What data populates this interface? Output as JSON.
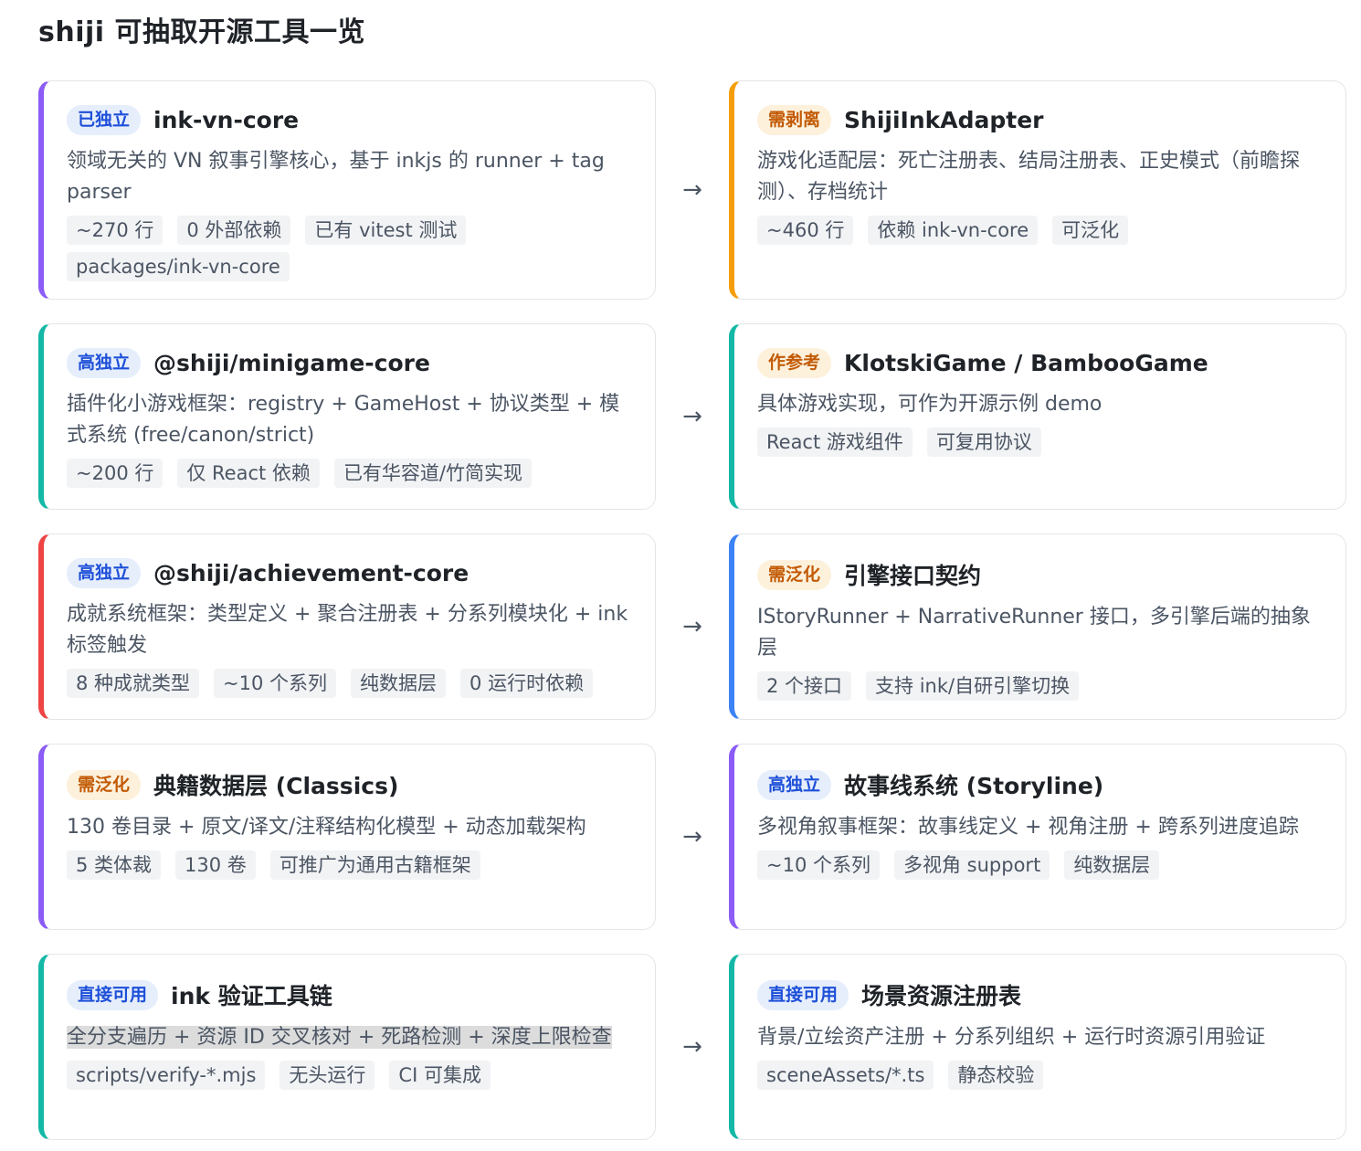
{
  "title": "shiji 可抽取开源工具一览",
  "colors": {
    "purple": "#8b5cf6",
    "orange": "#f59e0b",
    "green": "#14b8a6",
    "red": "#ef4444",
    "blue": "#3b82f6"
  },
  "arrow": "→",
  "rows": [
    {
      "left": {
        "badge": "已独立",
        "name": "ink-vn-core",
        "desc": "领域无关的 VN 叙事引擎核心，基于 inkjs 的 runner + tag parser",
        "tags": [
          "~270 行",
          "0 外部依赖",
          "已有 vitest 测试",
          "packages/ink-vn-core"
        ]
      },
      "right": {
        "badge": "需剥离",
        "name": "ShijiInkAdapter",
        "desc": "游戏化适配层：死亡注册表、结局注册表、正史模式（前瞻探测）、存档统计",
        "tags": [
          "~460 行",
          "依赖 ink-vn-core",
          "可泛化"
        ]
      }
    },
    {
      "left": {
        "badge": "高独立",
        "name": "@shiji/minigame-core",
        "desc": "插件化小游戏框架：registry + GameHost + 协议类型 + 模式系统 (free/canon/strict)",
        "tags": [
          "~200 行",
          "仅 React 依赖",
          "已有华容道/竹简实现"
        ]
      },
      "right": {
        "badge": "作参考",
        "name": "KlotskiGame / BambooGame",
        "desc": "具体游戏实现，可作为开源示例 demo",
        "tags": [
          "React 游戏组件",
          "可复用协议"
        ]
      }
    },
    {
      "left": {
        "badge": "高独立",
        "name": "@shiji/achievement-core",
        "desc": "成就系统框架：类型定义 + 聚合注册表 + 分系列模块化 + ink 标签触发",
        "tags": [
          "8 种成就类型",
          "~10 个系列",
          "纯数据层",
          "0 运行时依赖"
        ]
      },
      "right": {
        "badge": "需泛化",
        "name": "引擎接口契约",
        "desc": "IStoryRunner + NarrativeRunner 接口，多引擎后端的抽象层",
        "tags": [
          "2 个接口",
          "支持 ink/自研引擎切换"
        ]
      }
    },
    {
      "left": {
        "badge": "需泛化",
        "name": "典籍数据层 (Classics)",
        "desc": "130 卷目录 + 原文/译文/注释结构化模型 + 动态加载架构",
        "tags": [
          "5 类体裁",
          "130 卷",
          "可推广为通用古籍框架"
        ]
      },
      "right": {
        "badge": "高独立",
        "name": "故事线系统 (Storyline)",
        "desc": "多视角叙事框架：故事线定义 + 视角注册 + 跨系列进度追踪",
        "tags": [
          "~10 个系列",
          "多视角 support",
          "纯数据层"
        ]
      }
    },
    {
      "left": {
        "badge": "直接可用",
        "name": "ink 验证工具链",
        "desc": "全分支遍历 + 资源 ID 交叉核对 + 死路检测 + 深度上限检查",
        "tags": [
          "scripts/verify-*.mjs",
          "无头运行",
          "CI 可集成"
        ]
      },
      "right": {
        "badge": "直接可用",
        "name": "场景资源注册表",
        "desc": "背景/立绘资产注册 + 分系列组织 + 运行时资源引用验证",
        "tags": [
          "sceneAssets/*.ts",
          "静态校验"
        ]
      }
    }
  ]
}
